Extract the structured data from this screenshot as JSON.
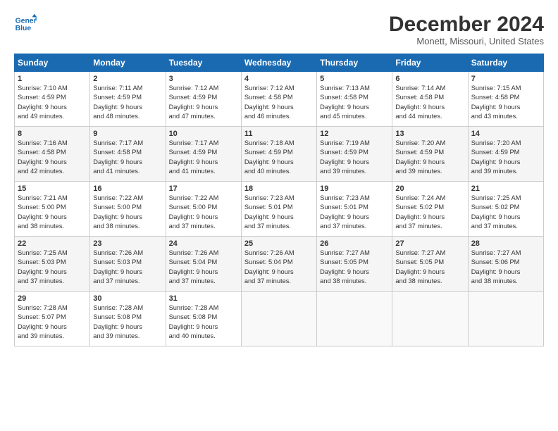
{
  "logo": {
    "line1": "General",
    "line2": "Blue"
  },
  "title": "December 2024",
  "location": "Monett, Missouri, United States",
  "days_header": [
    "Sunday",
    "Monday",
    "Tuesday",
    "Wednesday",
    "Thursday",
    "Friday",
    "Saturday"
  ],
  "weeks": [
    [
      {
        "day": "1",
        "sunrise": "7:10 AM",
        "sunset": "4:59 PM",
        "daylight_hours": "9",
        "daylight_min": "49"
      },
      {
        "day": "2",
        "sunrise": "7:11 AM",
        "sunset": "4:59 PM",
        "daylight_hours": "9",
        "daylight_min": "48"
      },
      {
        "day": "3",
        "sunrise": "7:12 AM",
        "sunset": "4:59 PM",
        "daylight_hours": "9",
        "daylight_min": "47"
      },
      {
        "day": "4",
        "sunrise": "7:12 AM",
        "sunset": "4:58 PM",
        "daylight_hours": "9",
        "daylight_min": "46"
      },
      {
        "day": "5",
        "sunrise": "7:13 AM",
        "sunset": "4:58 PM",
        "daylight_hours": "9",
        "daylight_min": "45"
      },
      {
        "day": "6",
        "sunrise": "7:14 AM",
        "sunset": "4:58 PM",
        "daylight_hours": "9",
        "daylight_min": "44"
      },
      {
        "day": "7",
        "sunrise": "7:15 AM",
        "sunset": "4:58 PM",
        "daylight_hours": "9",
        "daylight_min": "43"
      }
    ],
    [
      {
        "day": "8",
        "sunrise": "7:16 AM",
        "sunset": "4:58 PM",
        "daylight_hours": "9",
        "daylight_min": "42"
      },
      {
        "day": "9",
        "sunrise": "7:17 AM",
        "sunset": "4:58 PM",
        "daylight_hours": "9",
        "daylight_min": "41"
      },
      {
        "day": "10",
        "sunrise": "7:17 AM",
        "sunset": "4:59 PM",
        "daylight_hours": "9",
        "daylight_min": "41"
      },
      {
        "day": "11",
        "sunrise": "7:18 AM",
        "sunset": "4:59 PM",
        "daylight_hours": "9",
        "daylight_min": "40"
      },
      {
        "day": "12",
        "sunrise": "7:19 AM",
        "sunset": "4:59 PM",
        "daylight_hours": "9",
        "daylight_min": "39"
      },
      {
        "day": "13",
        "sunrise": "7:20 AM",
        "sunset": "4:59 PM",
        "daylight_hours": "9",
        "daylight_min": "39"
      },
      {
        "day": "14",
        "sunrise": "7:20 AM",
        "sunset": "4:59 PM",
        "daylight_hours": "9",
        "daylight_min": "39"
      }
    ],
    [
      {
        "day": "15",
        "sunrise": "7:21 AM",
        "sunset": "5:00 PM",
        "daylight_hours": "9",
        "daylight_min": "38"
      },
      {
        "day": "16",
        "sunrise": "7:22 AM",
        "sunset": "5:00 PM",
        "daylight_hours": "9",
        "daylight_min": "38"
      },
      {
        "day": "17",
        "sunrise": "7:22 AM",
        "sunset": "5:00 PM",
        "daylight_hours": "9",
        "daylight_min": "37"
      },
      {
        "day": "18",
        "sunrise": "7:23 AM",
        "sunset": "5:01 PM",
        "daylight_hours": "9",
        "daylight_min": "37"
      },
      {
        "day": "19",
        "sunrise": "7:23 AM",
        "sunset": "5:01 PM",
        "daylight_hours": "9",
        "daylight_min": "37"
      },
      {
        "day": "20",
        "sunrise": "7:24 AM",
        "sunset": "5:02 PM",
        "daylight_hours": "9",
        "daylight_min": "37"
      },
      {
        "day": "21",
        "sunrise": "7:25 AM",
        "sunset": "5:02 PM",
        "daylight_hours": "9",
        "daylight_min": "37"
      }
    ],
    [
      {
        "day": "22",
        "sunrise": "7:25 AM",
        "sunset": "5:03 PM",
        "daylight_hours": "9",
        "daylight_min": "37"
      },
      {
        "day": "23",
        "sunrise": "7:26 AM",
        "sunset": "5:03 PM",
        "daylight_hours": "9",
        "daylight_min": "37"
      },
      {
        "day": "24",
        "sunrise": "7:26 AM",
        "sunset": "5:04 PM",
        "daylight_hours": "9",
        "daylight_min": "37"
      },
      {
        "day": "25",
        "sunrise": "7:26 AM",
        "sunset": "5:04 PM",
        "daylight_hours": "9",
        "daylight_min": "37"
      },
      {
        "day": "26",
        "sunrise": "7:27 AM",
        "sunset": "5:05 PM",
        "daylight_hours": "9",
        "daylight_min": "38"
      },
      {
        "day": "27",
        "sunrise": "7:27 AM",
        "sunset": "5:05 PM",
        "daylight_hours": "9",
        "daylight_min": "38"
      },
      {
        "day": "28",
        "sunrise": "7:27 AM",
        "sunset": "5:06 PM",
        "daylight_hours": "9",
        "daylight_min": "38"
      }
    ],
    [
      {
        "day": "29",
        "sunrise": "7:28 AM",
        "sunset": "5:07 PM",
        "daylight_hours": "9",
        "daylight_min": "39"
      },
      {
        "day": "30",
        "sunrise": "7:28 AM",
        "sunset": "5:08 PM",
        "daylight_hours": "9",
        "daylight_min": "39"
      },
      {
        "day": "31",
        "sunrise": "7:28 AM",
        "sunset": "5:08 PM",
        "daylight_hours": "9",
        "daylight_min": "40"
      },
      null,
      null,
      null,
      null
    ]
  ]
}
